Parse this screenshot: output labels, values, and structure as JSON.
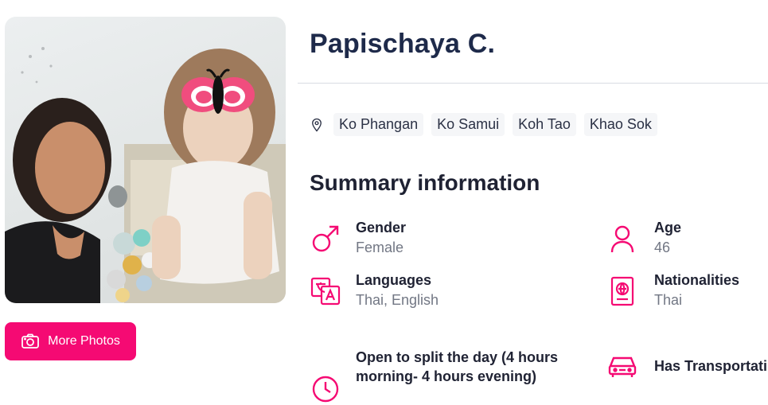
{
  "profile": {
    "name": "Papischaya C.",
    "more_photos_label": "More Photos"
  },
  "locations": [
    "Ko Phangan",
    "Ko Samui",
    "Koh Tao",
    "Khao Sok"
  ],
  "summary": {
    "title": "Summary information",
    "gender": {
      "label": "Gender",
      "value": "Female",
      "icon": "male-symbol-icon"
    },
    "age": {
      "label": "Age",
      "value": "46",
      "icon": "person-icon"
    },
    "languages": {
      "label": "Languages",
      "value": "Thai, English",
      "icon": "translate-icon"
    },
    "nationalities": {
      "label": "Nationalities",
      "value": "Thai",
      "icon": "passport-icon"
    },
    "availability": {
      "label": "Open to split the day (4 hours morning- 4 hours evening)",
      "icon": "clock-icon"
    },
    "transportation": {
      "label": "Has Transportati",
      "icon": "car-icon"
    }
  },
  "colors": {
    "accent": "#f50a73",
    "heading": "#1e2a4a",
    "muted": "#727784"
  }
}
